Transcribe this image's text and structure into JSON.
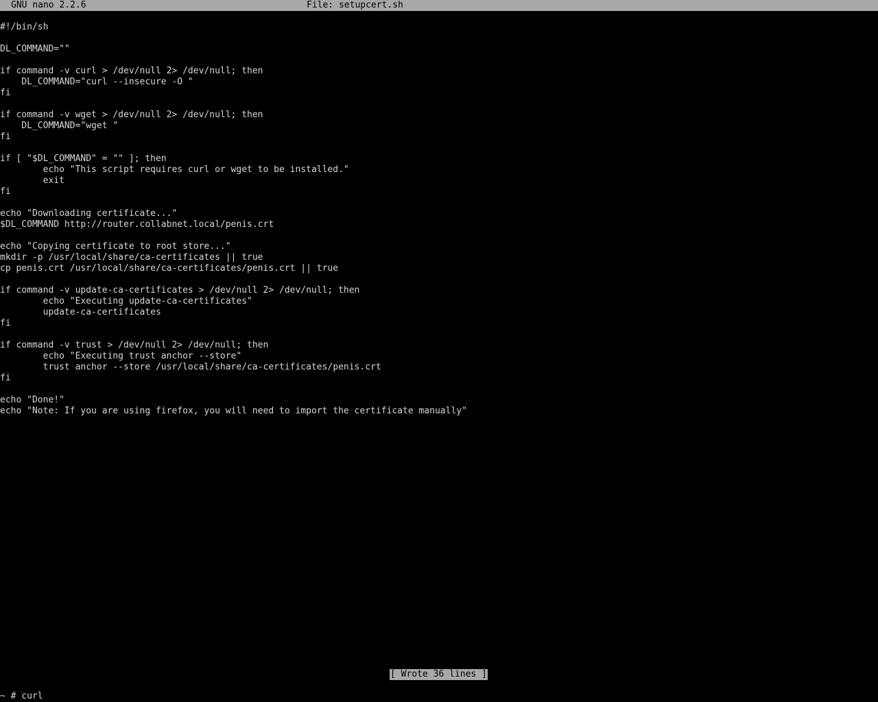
{
  "title_bar": {
    "app_name": "GNU nano 2.2.6",
    "file_label": "File: setupcert.sh"
  },
  "editor": {
    "lines": [
      "#!/bin/sh",
      "",
      "DL_COMMAND=\"\"",
      "",
      "if command -v curl > /dev/null 2> /dev/null; then",
      "    DL_COMMAND=\"curl --insecure -O \"",
      "fi",
      "",
      "if command -v wget > /dev/null 2> /dev/null; then",
      "    DL_COMMAND=\"wget \"",
      "fi",
      "",
      "if [ \"$DL_COMMAND\" = \"\" ]; then",
      "        echo \"This script requires curl or wget to be installed.\"",
      "        exit",
      "fi",
      "",
      "echo \"Downloading certificate...\"",
      "$DL_COMMAND http://router.collabnet.local/penis.crt",
      "",
      "echo \"Copying certificate to root store...\"",
      "mkdir -p /usr/local/share/ca-certificates || true",
      "cp penis.crt /usr/local/share/ca-certificates/penis.crt || true",
      "",
      "if command -v update-ca-certificates > /dev/null 2> /dev/null; then",
      "        echo \"Executing update-ca-certificates\"",
      "        update-ca-certificates",
      "fi",
      "",
      "if command -v trust > /dev/null 2> /dev/null; then",
      "        echo \"Executing trust anchor --store\"",
      "        trust anchor --store /usr/local/share/ca-certificates/penis.crt",
      "fi",
      "",
      "echo \"Done!\"",
      "echo \"Note: If you are using firefox, you will need to import the certificate manually\""
    ]
  },
  "status_bar": {
    "message": "[ Wrote 36 lines ]"
  },
  "shell": {
    "prompt": "~ # curl"
  },
  "colors": {
    "background": "#000000",
    "text": "#d6d6d6",
    "inverse_bar": "#a8a8a8",
    "inverse_text": "#000000"
  }
}
